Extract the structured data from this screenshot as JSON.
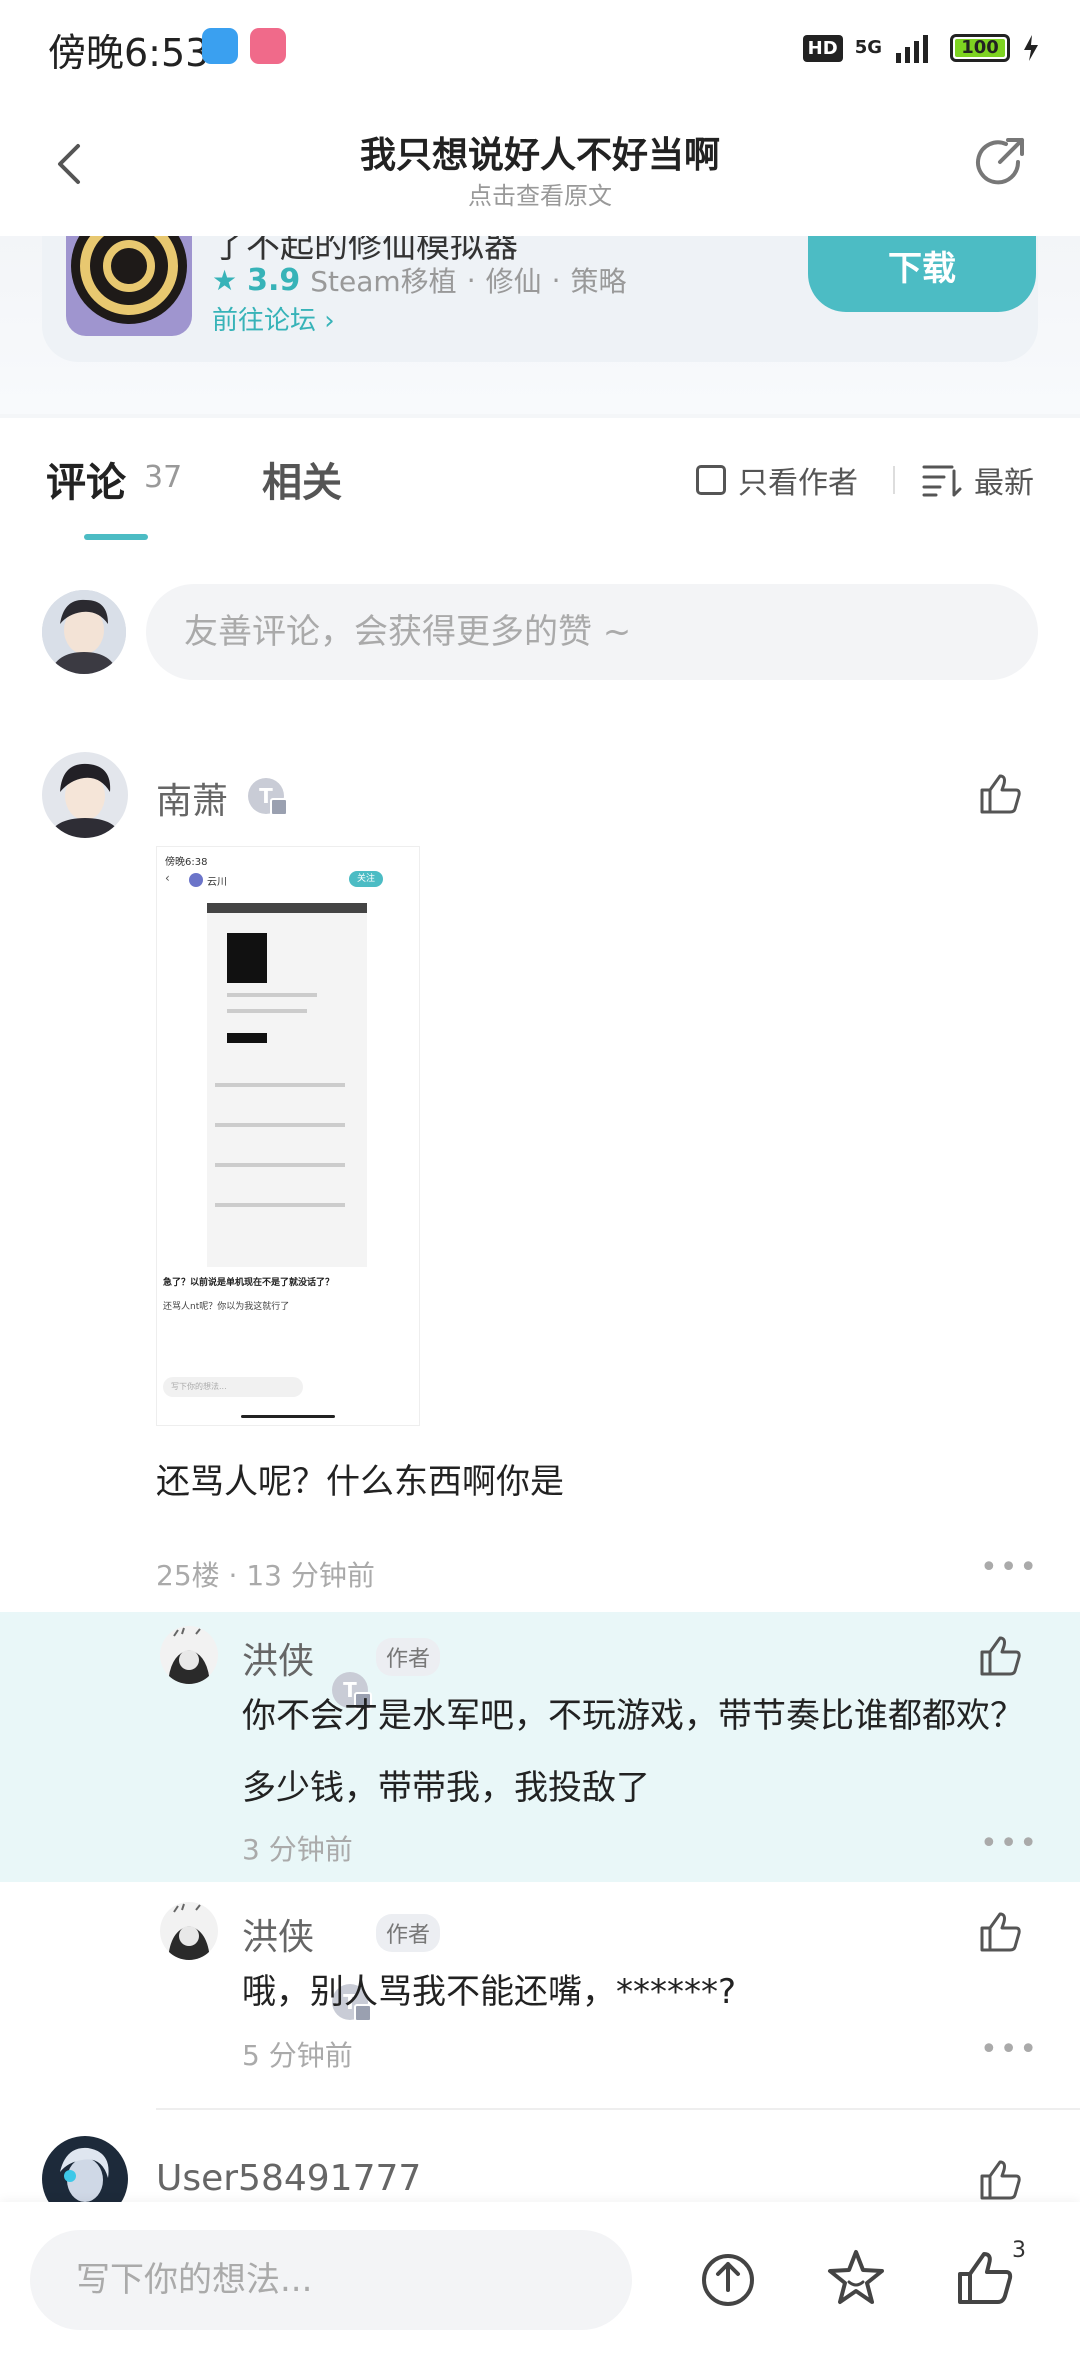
{
  "status_bar": {
    "time": "傍晚6:53",
    "hd": "HD",
    "network": "5G",
    "battery": "100"
  },
  "header": {
    "title": "我只想说好人不好当啊",
    "subtitle": "点击查看原文"
  },
  "game_card": {
    "name": "了不起的修仙模拟器",
    "rating": "3.9",
    "tags": [
      "Steam移植",
      "修仙",
      "策略"
    ],
    "forum_link": "前往论坛",
    "download_label": "下载"
  },
  "tabs": {
    "comments_label": "评论",
    "comments_count": "37",
    "related_label": "相关"
  },
  "filters": {
    "only_author": "只看作者",
    "sort": "最新"
  },
  "comment_input": {
    "placeholder": "友善评论，会获得更多的赞 ~"
  },
  "comments": [
    {
      "user": "南萧",
      "level": "T",
      "text": "还骂人呢？什么东西啊你是",
      "floor": "25楼",
      "time": "13 分钟前",
      "embedded_screenshot": {
        "time": "傍晚6:38",
        "user": "云川",
        "follow": "关注",
        "question": "急了？以前说是单机现在不是了就没话了？",
        "reply": "还骂人nt呢？你以为我这就行了",
        "input": "写下你的想法..."
      },
      "replies": [
        {
          "user": "洪侠",
          "level": "T",
          "tag": "作者",
          "text": "你不会才是水军吧，不玩游戏，带节奏比谁都都欢？多少钱，带带我，我投敌了",
          "time": "3 分钟前"
        },
        {
          "user": "洪侠",
          "level": "T",
          "tag": "作者",
          "text": "哦，别人骂我不能还嘴，******?",
          "time": "5 分钟前"
        }
      ]
    },
    {
      "user": "User58491777",
      "level": "T"
    }
  ],
  "bottom_bar": {
    "placeholder": "写下你的想法...",
    "like_count": "3"
  },
  "colors": {
    "accent": "#4cbcc4",
    "highlight": "#e9f7f8"
  }
}
